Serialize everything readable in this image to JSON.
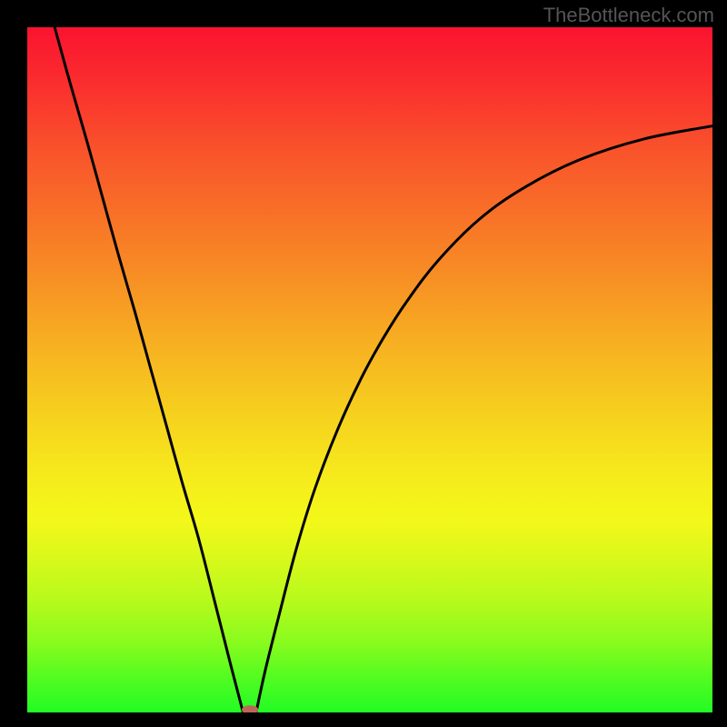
{
  "watermark": "TheBottleneck.com",
  "colors": {
    "curve_stroke": "#000000",
    "dot_fill": "#bb6956",
    "frame_bg": "#000000"
  },
  "chart_data": {
    "type": "line",
    "title": "",
    "xlabel": "",
    "ylabel": "",
    "xlim": [
      0,
      100
    ],
    "ylim": [
      0,
      100
    ],
    "grid": false,
    "series": [
      {
        "name": "left-branch",
        "x": [
          4.0,
          6.3,
          8.7,
          11.0,
          13.3,
          15.7,
          18.0,
          20.3,
          22.6,
          25.0,
          27.3,
          29.7,
          31.5
        ],
        "y": [
          100.0,
          91.7,
          83.4,
          75.1,
          66.8,
          58.5,
          50.2,
          41.9,
          33.6,
          25.4,
          16.4,
          6.9,
          0.0
        ]
      },
      {
        "name": "right-branch",
        "x": [
          33.4,
          34.7,
          36.7,
          39.3,
          42.0,
          45.3,
          48.7,
          52.0,
          55.4,
          60.0,
          66.0,
          72.7,
          80.7,
          90.0,
          100.0
        ],
        "y": [
          0.0,
          6.0,
          14.0,
          24.0,
          32.7,
          41.3,
          48.7,
          54.7,
          60.0,
          66.0,
          72.0,
          76.7,
          80.7,
          83.7,
          85.6
        ]
      }
    ],
    "annotations": [
      {
        "kind": "dot",
        "x": 32.5,
        "y": 0.0,
        "rx": 1.2,
        "ry": 0.65
      }
    ]
  }
}
